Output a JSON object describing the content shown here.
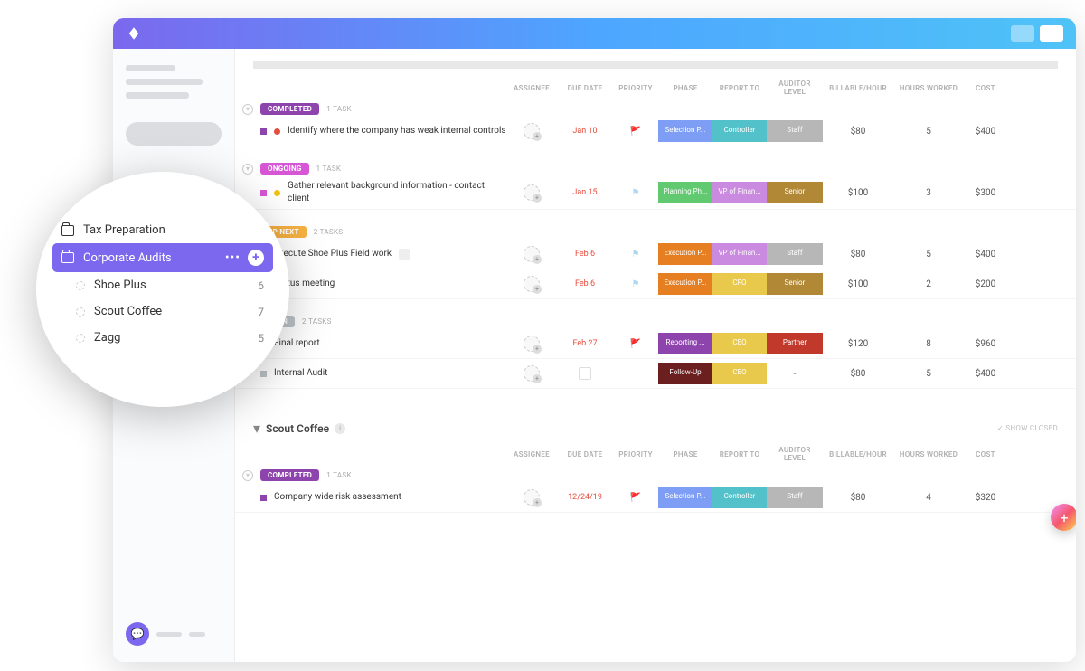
{
  "sidebar_popup": {
    "items": [
      {
        "icon": "folder",
        "label": "Tax Preparation",
        "active": false
      },
      {
        "icon": "folder",
        "label": "Corporate Audits",
        "active": true,
        "actions": true
      },
      {
        "icon": "list",
        "label": "Shoe Plus",
        "count": "6",
        "indent": true
      },
      {
        "icon": "list",
        "label": "Scout Coffee",
        "count": "7",
        "indent": true
      },
      {
        "icon": "list",
        "label": "Zagg",
        "count": "5",
        "indent": true
      }
    ]
  },
  "columns": [
    "",
    "ASSIGNEE",
    "DUE DATE",
    "PRIORITY",
    "PHASE",
    "REPORT TO",
    "AUDITOR LEVEL",
    "BILLABLE/HOUR",
    "HOURS WORKED",
    "COST"
  ],
  "groups": [
    {
      "status": "COMPLETED",
      "status_color": "#8e44ad",
      "count": "1 TASK",
      "tasks": [
        {
          "marker": "sq",
          "marker_color": "#8e44ad",
          "dot": "#e74c3c",
          "name": "Identify where the company has weak internal controls",
          "due": "Jan 10",
          "flag": "🚩",
          "flag_color": "#f1c40f",
          "phase": "Selection P...",
          "phase_c": "#7e9ef5",
          "report": "Controller",
          "report_c": "#52c1c9",
          "level": "Staff",
          "level_c": "#b7b7b7",
          "rate": "$80",
          "hours": "5",
          "cost": "$400"
        }
      ]
    },
    {
      "status": "ONGOING",
      "status_color": "#d656d6",
      "count": "1 TASK",
      "tasks": [
        {
          "marker": "sq",
          "marker_color": "#d656d6",
          "dot": "#f1c40f",
          "name": "Gather relevant background information - contact client",
          "due": "Jan 15",
          "flag": "⚑",
          "flag_color": "#aed6f1",
          "phase": "Planning Ph...",
          "phase_c": "#61c96f",
          "report": "VP of Finan...",
          "report_c": "#c98ae0",
          "level": "Senior",
          "level_c": "#b08836",
          "rate": "$100",
          "hours": "3",
          "cost": "$300"
        }
      ]
    },
    {
      "status": "UP NEXT",
      "status_color": "#f5b041",
      "count": "2 TASKS",
      "tasks": [
        {
          "marker": "sq",
          "marker_color": "#f5b041",
          "dot": "",
          "name": "Execute Shoe Plus Field work",
          "badge": true,
          "due": "Feb 6",
          "flag": "⚑",
          "flag_color": "#aed6f1",
          "phase": "Execution P...",
          "phase_c": "#e67e22",
          "report": "VP of Finan...",
          "report_c": "#c98ae0",
          "level": "Staff",
          "level_c": "#b7b7b7",
          "rate": "$80",
          "hours": "5",
          "cost": "$400"
        },
        {
          "marker": "sq",
          "marker_color": "#f5b041",
          "dot": "",
          "name": "Status meeting",
          "due": "Feb 6",
          "flag": "⚑",
          "flag_color": "#aed6f1",
          "phase": "Execution P...",
          "phase_c": "#e67e22",
          "report": "CFO",
          "report_c": "#e9c94c",
          "level": "Senior",
          "level_c": "#b08836",
          "rate": "$100",
          "hours": "2",
          "cost": "$200"
        }
      ]
    },
    {
      "status": "OPEN",
      "status_color": "#bdc3c7",
      "count": "2 TASKS",
      "tasks": [
        {
          "marker": "sq",
          "marker_color": "#bdc3c7",
          "dot": "",
          "name": "Final report",
          "due": "Feb 27",
          "flag": "🚩",
          "flag_color": "#e74c3c",
          "phase": "Reporting ...",
          "phase_c": "#8e44ad",
          "report": "CEO",
          "report_c": "#e9c94c",
          "level": "Partner",
          "level_c": "#c0392b",
          "rate": "$120",
          "hours": "8",
          "cost": "$960"
        },
        {
          "marker": "sq",
          "marker_color": "#bdc3c7",
          "dot": "",
          "name": "Internal Audit",
          "due": "",
          "due_icon": true,
          "flag": "",
          "flag_color": "",
          "phase": "Follow-Up",
          "phase_c": "#6b1f1f",
          "report": "CEO",
          "report_c": "#e9c94c",
          "level": "-",
          "level_c": "",
          "rate": "$80",
          "hours": "5",
          "cost": "$400"
        }
      ]
    }
  ],
  "second_section": {
    "title": "Scout Coffee",
    "show_closed": "✓ SHOW CLOSED",
    "groups": [
      {
        "status": "COMPLETED",
        "status_color": "#8e44ad",
        "count": "1 TASK",
        "tasks": [
          {
            "marker": "sq",
            "marker_color": "#8e44ad",
            "dot": "",
            "name": "Company wide risk assessment",
            "due": "12/24/19",
            "flag": "🚩",
            "flag_color": "#f1c40f",
            "phase": "Selection P...",
            "phase_c": "#7e9ef5",
            "report": "Controller",
            "report_c": "#52c1c9",
            "level": "Staff",
            "level_c": "#b7b7b7",
            "rate": "$80",
            "hours": "4",
            "cost": "$320"
          }
        ]
      }
    ]
  }
}
